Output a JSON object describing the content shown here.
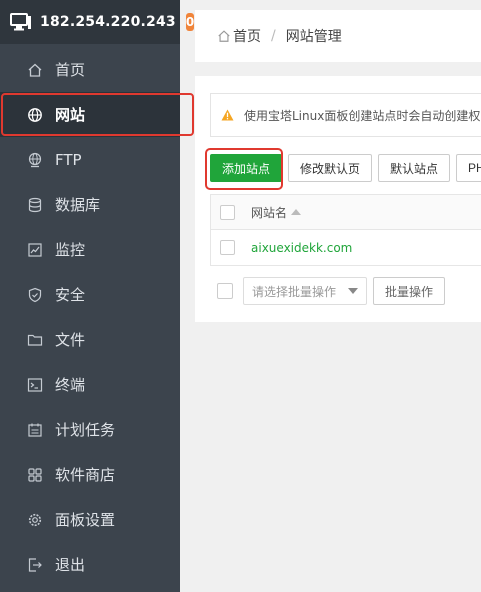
{
  "sidebar": {
    "ip": "182.254.220.243",
    "badge": "0",
    "items": [
      {
        "label": "首页",
        "icon": "home-icon"
      },
      {
        "label": "网站",
        "icon": "globe-icon",
        "active": true
      },
      {
        "label": "FTP",
        "icon": "ftp-globe-icon"
      },
      {
        "label": "数据库",
        "icon": "database-icon"
      },
      {
        "label": "监控",
        "icon": "monitor-icon"
      },
      {
        "label": "安全",
        "icon": "shield-icon"
      },
      {
        "label": "文件",
        "icon": "folder-icon"
      },
      {
        "label": "终端",
        "icon": "terminal-icon"
      },
      {
        "label": "计划任务",
        "icon": "calendar-icon"
      },
      {
        "label": "软件商店",
        "icon": "grid-icon"
      },
      {
        "label": "面板设置",
        "icon": "gear-icon"
      },
      {
        "label": "退出",
        "icon": "logout-icon"
      }
    ]
  },
  "breadcrumb": {
    "home": "首页",
    "separator": "/",
    "current": "网站管理"
  },
  "alert": {
    "text": "使用宝塔Linux面板创建站点时会自动创建权限"
  },
  "toolbar": {
    "add_site": "添加站点",
    "edit_default_page": "修改默认页",
    "default_site": "默认站点",
    "php": "PHP"
  },
  "table": {
    "columns": [
      "网站名"
    ],
    "rows": [
      {
        "name": "aixuexidekk.com"
      }
    ]
  },
  "batch": {
    "select_placeholder": "请选择批量操作",
    "button": "批量操作"
  },
  "colors": {
    "sidebar_bg": "#3c444d",
    "accent_green": "#20a53a",
    "highlight_red": "#e0392f",
    "badge_orange": "#f0843a"
  }
}
